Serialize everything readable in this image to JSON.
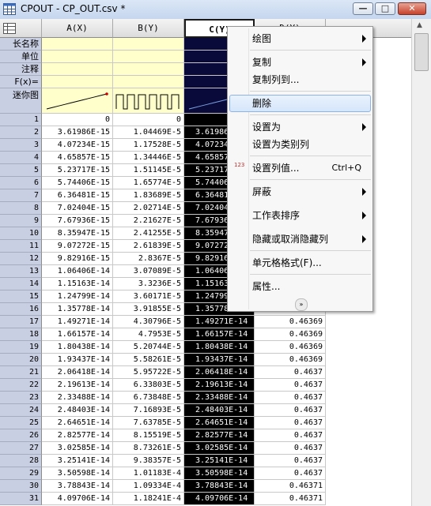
{
  "window": {
    "title": "CPOUT - CP_OUT.csv *",
    "minimize": "—",
    "maximize": "□",
    "close": "✕"
  },
  "sheet": {
    "corner_label": "",
    "columns": [
      "A(X)",
      "B(Y)",
      "C(Y)",
      "D(Y)"
    ],
    "meta_labels": [
      "长名称",
      "单位",
      "注释",
      "F(x)=",
      "迷你图"
    ],
    "rows": [
      {
        "n": "1",
        "a": "0",
        "b": "0",
        "c": "",
        "d": ""
      },
      {
        "n": "2",
        "a": "3.61986E-15",
        "b": "1.04469E-5",
        "c": "3.61986E-15",
        "d": ""
      },
      {
        "n": "3",
        "a": "4.07234E-15",
        "b": "1.17528E-5",
        "c": "4.07234E-15",
        "d": ""
      },
      {
        "n": "4",
        "a": "4.65857E-15",
        "b": "1.34446E-5",
        "c": "4.65857E-15",
        "d": ""
      },
      {
        "n": "5",
        "a": "5.23717E-15",
        "b": "1.51145E-5",
        "c": "5.23717E-15",
        "d": ""
      },
      {
        "n": "6",
        "a": "5.74406E-15",
        "b": "1.65774E-5",
        "c": "5.74406E-15",
        "d": ""
      },
      {
        "n": "7",
        "a": "6.36481E-15",
        "b": "1.83689E-5",
        "c": "6.36481E-15",
        "d": ""
      },
      {
        "n": "8",
        "a": "7.02404E-15",
        "b": "2.02714E-5",
        "c": "7.02404E-15",
        "d": ""
      },
      {
        "n": "9",
        "a": "7.67936E-15",
        "b": "2.21627E-5",
        "c": "7.67936E-15",
        "d": ""
      },
      {
        "n": "10",
        "a": "8.35947E-15",
        "b": "2.41255E-5",
        "c": "8.35947E-15",
        "d": ""
      },
      {
        "n": "11",
        "a": "9.07272E-15",
        "b": "2.61839E-5",
        "c": "9.07272E-15",
        "d": ""
      },
      {
        "n": "12",
        "a": "9.82916E-15",
        "b": "2.8367E-5",
        "c": "9.82916E-15",
        "d": ""
      },
      {
        "n": "13",
        "a": "1.06406E-14",
        "b": "3.07089E-5",
        "c": "1.06406E-14",
        "d": ""
      },
      {
        "n": "14",
        "a": "1.15163E-14",
        "b": "3.3236E-5",
        "c": "1.15163E-14",
        "d": ""
      },
      {
        "n": "15",
        "a": "1.24799E-14",
        "b": "3.60171E-5",
        "c": "1.24799E-14",
        "d": ""
      },
      {
        "n": "16",
        "a": "1.35778E-14",
        "b": "3.91855E-5",
        "c": "1.35778E-14",
        "d": ""
      },
      {
        "n": "17",
        "a": "1.49271E-14",
        "b": "4.30796E-5",
        "c": "1.49271E-14",
        "d": "0.46369"
      },
      {
        "n": "18",
        "a": "1.66157E-14",
        "b": "4.7953E-5",
        "c": "1.66157E-14",
        "d": "0.46369"
      },
      {
        "n": "19",
        "a": "1.80438E-14",
        "b": "5.20744E-5",
        "c": "1.80438E-14",
        "d": "0.46369"
      },
      {
        "n": "20",
        "a": "1.93437E-14",
        "b": "5.58261E-5",
        "c": "1.93437E-14",
        "d": "0.46369"
      },
      {
        "n": "21",
        "a": "2.06418E-14",
        "b": "5.95722E-5",
        "c": "2.06418E-14",
        "d": "0.4637"
      },
      {
        "n": "22",
        "a": "2.19613E-14",
        "b": "6.33803E-5",
        "c": "2.19613E-14",
        "d": "0.4637"
      },
      {
        "n": "23",
        "a": "2.33488E-14",
        "b": "6.73848E-5",
        "c": "2.33488E-14",
        "d": "0.4637"
      },
      {
        "n": "24",
        "a": "2.48403E-14",
        "b": "7.16893E-5",
        "c": "2.48403E-14",
        "d": "0.4637"
      },
      {
        "n": "25",
        "a": "2.64651E-14",
        "b": "7.63785E-5",
        "c": "2.64651E-14",
        "d": "0.4637"
      },
      {
        "n": "26",
        "a": "2.82577E-14",
        "b": "8.15519E-5",
        "c": "2.82577E-14",
        "d": "0.4637"
      },
      {
        "n": "27",
        "a": "3.02585E-14",
        "b": "8.73261E-5",
        "c": "3.02585E-14",
        "d": "0.4637"
      },
      {
        "n": "28",
        "a": "3.25141E-14",
        "b": "9.38357E-5",
        "c": "3.25141E-14",
        "d": "0.4637"
      },
      {
        "n": "29",
        "a": "3.50598E-14",
        "b": "1.01183E-4",
        "c": "3.50598E-14",
        "d": "0.4637"
      },
      {
        "n": "30",
        "a": "3.78843E-14",
        "b": "1.09334E-4",
        "c": "3.78843E-14",
        "d": "0.46371"
      },
      {
        "n": "31",
        "a": "4.09706E-14",
        "b": "1.18241E-4",
        "c": "4.09706E-14",
        "d": "0.46371"
      }
    ]
  },
  "context_menu": {
    "items": [
      {
        "label": "绘图",
        "submenu": true,
        "shortcut": "",
        "icon": ""
      },
      {
        "label": "复制",
        "submenu": true,
        "shortcut": "",
        "icon": ""
      },
      {
        "label": "复制列到...",
        "submenu": false,
        "shortcut": "",
        "icon": ""
      },
      {
        "label": "删除",
        "submenu": false,
        "shortcut": "",
        "icon": "",
        "highlighted": true
      },
      {
        "label": "设置为",
        "submenu": true,
        "shortcut": "",
        "icon": ""
      },
      {
        "label": "设置为类别列",
        "submenu": false,
        "shortcut": "",
        "icon": ""
      },
      {
        "label": "设置列值...",
        "submenu": false,
        "shortcut": "Ctrl+Q",
        "icon": "123"
      },
      {
        "label": "屏蔽",
        "submenu": true,
        "shortcut": "",
        "icon": ""
      },
      {
        "label": "工作表排序",
        "submenu": true,
        "shortcut": "",
        "icon": ""
      },
      {
        "label": "隐藏或取消隐藏列",
        "submenu": true,
        "shortcut": "",
        "icon": ""
      },
      {
        "label": "单元格格式(F)...",
        "submenu": false,
        "shortcut": "",
        "icon": ""
      },
      {
        "label": "属性...",
        "submenu": false,
        "shortcut": "",
        "icon": ""
      }
    ],
    "more_glyph": "»"
  },
  "colors": {
    "row_header": "#c9cfe3",
    "meta_fill": "#ffffcc",
    "selected_column": "#000000",
    "menu_highlight": "#d6e6fb"
  }
}
